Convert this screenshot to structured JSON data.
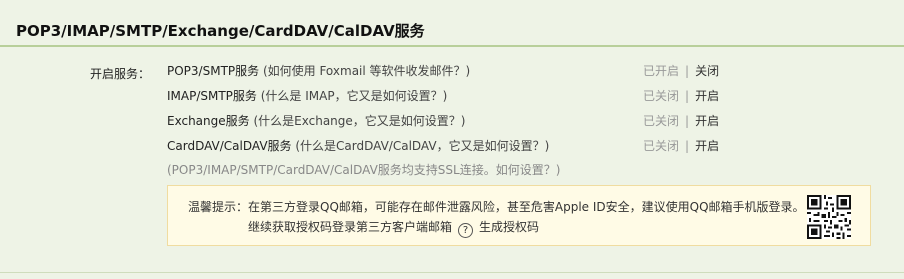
{
  "section": {
    "title": "POP3/IMAP/SMTP/Exchange/CardDAV/CalDAV服务"
  },
  "services_label": "开启服务：",
  "services": [
    {
      "name": "POP3/SMTP服务",
      "help": " (如何使用 Foxmail 等软件收发邮件？)",
      "state": "已开启",
      "action": "关闭"
    },
    {
      "name": "IMAP/SMTP服务",
      "help": " (什么是 IMAP，它又是如何设置？)",
      "state": "已关闭",
      "action": "开启"
    },
    {
      "name": "Exchange服务",
      "help": " (什么是Exchange，它又是如何设置？)",
      "state": "已关闭",
      "action": "开启"
    },
    {
      "name": "CardDAV/CalDAV服务",
      "help": " (什么是CardDAV/CalDAV，它又是如何设置？)",
      "state": "已关闭",
      "action": "开启"
    }
  ],
  "separator": "|",
  "ssl_note": "(POP3/IMAP/SMTP/CardDAV/CalDAV服务均支持SSL连接。如何设置？)",
  "tip": {
    "label": "温馨提示：",
    "line1": "在第三方登录QQ邮箱，可能存在邮件泄露风险，甚至危害Apple ID安全，建议使用QQ邮箱手机版登录。",
    "line2": "继续获取授权码登录第三方客户端邮箱",
    "help_icon_text": "?",
    "generate_link": "生成授权码"
  },
  "icons": {
    "help": "help-circle-icon",
    "qr": "qr-code-icon"
  },
  "colors": {
    "background": "#eef3e6",
    "rule": "#b8cf9a",
    "tip_bg": "#fffbe6",
    "tip_border": "#f0dca0"
  }
}
